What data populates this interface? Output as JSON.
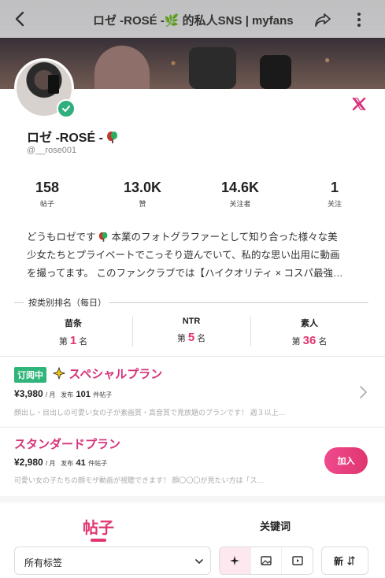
{
  "header": {
    "title": "ロゼ -ROSÉ -🌿 的私人SNS | myfans"
  },
  "profile": {
    "name": "ロゼ -ROSÉ -",
    "handle": "@__rose001",
    "verified": true,
    "social": "X"
  },
  "stats": [
    {
      "value": "158",
      "label": "帖子"
    },
    {
      "value": "13.0K",
      "label": "赞"
    },
    {
      "value": "14.6K",
      "label": "关注者"
    },
    {
      "value": "1",
      "label": "关注"
    }
  ],
  "bio": {
    "line1_pre": "どうもロゼです",
    "line1_post": " 本業のフォトグラファーとして知り合った様々な美",
    "line2": "少女たちとプライベートでこっそり遊んでいて、私的な思い出用に動画",
    "line3": "を撮ってます。 このファンクラブでは【ハイクオリティ × コスパ最強…"
  },
  "ranking": {
    "heading": "按类别排名（每日）",
    "items": [
      {
        "category": "苗条",
        "prefix": "第",
        "rank": "1",
        "suffix": "名"
      },
      {
        "category": "NTR",
        "prefix": "第",
        "rank": "5",
        "suffix": "名"
      },
      {
        "category": "素人",
        "prefix": "第",
        "rank": "36",
        "suffix": "名"
      }
    ]
  },
  "plans": [
    {
      "badge": "订阅中",
      "title": "スペシャルプラン",
      "price": "¥3,980",
      "per": "/ 月",
      "posts_prefix": "发布",
      "posts": "101",
      "posts_suffix": "件帖子",
      "desc": "顔出し・目出しの可愛い女の子が素画質・高音質で見放題のプランです！ 週３以上…"
    },
    {
      "title": "スタンダードプラン",
      "price": "¥2,980",
      "per": "/ 月",
      "posts_prefix": "发布",
      "posts": "41",
      "posts_suffix": "件帖子",
      "desc": "可愛い女の子たちの顔モザ動画が視聴できます！ 顔〇〇〇が見たい方は「ス…",
      "join_label": "加入"
    }
  ],
  "tabs": {
    "active": "帖子",
    "other": "关键词"
  },
  "filter": {
    "select_label": "所有标签",
    "sort_label": "新"
  },
  "colors": {
    "accent": "#e0366f",
    "verified": "#2eaf7d",
    "subscribed_badge": "#2fb479"
  }
}
